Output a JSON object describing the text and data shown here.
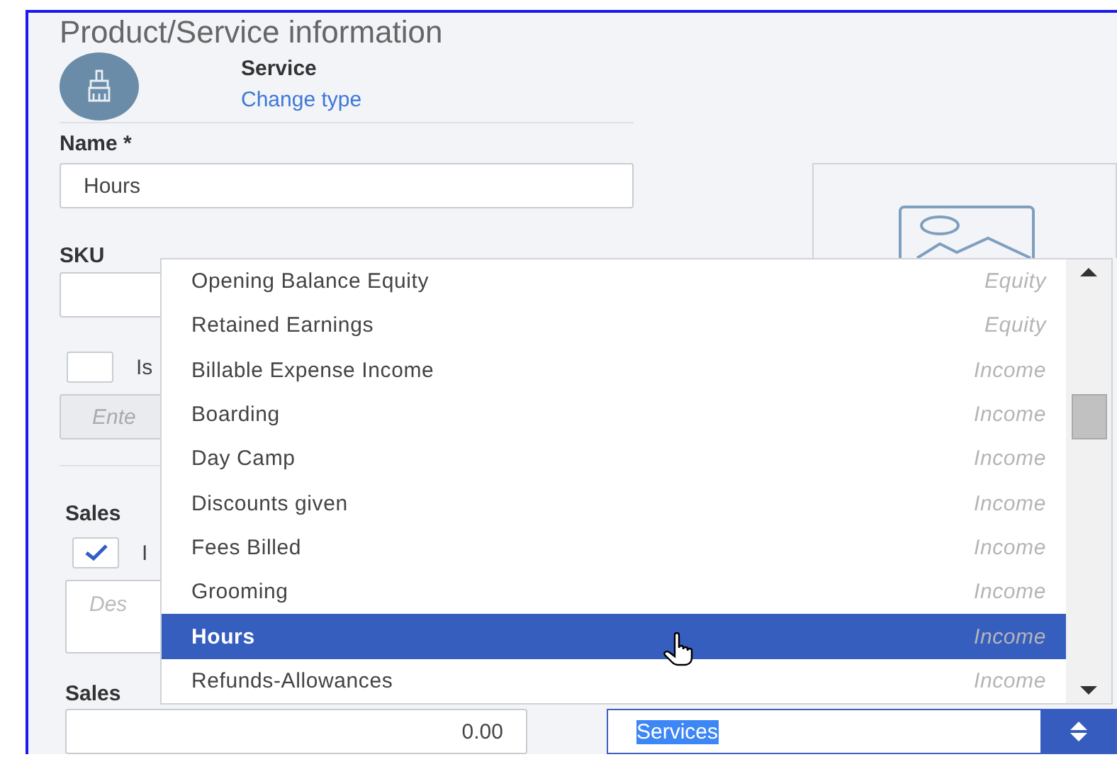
{
  "title": "Product/Service information",
  "item_type": {
    "label": "Service",
    "link": "Change type"
  },
  "name_field": {
    "label": "Name *",
    "value": "Hours"
  },
  "sku_field": {
    "label": "SKU"
  },
  "sub_product": {
    "checked": false,
    "label": "Is"
  },
  "parent_field": {
    "placeholder": "Ente",
    "disabled": true
  },
  "sales": {
    "heading": "Sales",
    "sell_checkbox": {
      "checked": true,
      "label": "I"
    },
    "description": {
      "placeholder": "Des"
    }
  },
  "price": {
    "label": "Sales",
    "value": "0.00"
  },
  "income_account": {
    "value": "Services"
  },
  "account_dropdown": {
    "items": [
      {
        "name": "Opening Balance Equity",
        "type": "Equity",
        "selected": false
      },
      {
        "name": "Retained Earnings",
        "type": "Equity",
        "selected": false
      },
      {
        "name": "Billable Expense Income",
        "type": "Income",
        "selected": false
      },
      {
        "name": "Boarding",
        "type": "Income",
        "selected": false
      },
      {
        "name": "Day Camp",
        "type": "Income",
        "selected": false
      },
      {
        "name": "Discounts given",
        "type": "Income",
        "selected": false
      },
      {
        "name": "Fees Billed",
        "type": "Income",
        "selected": false
      },
      {
        "name": "Grooming",
        "type": "Income",
        "selected": false
      },
      {
        "name": "Hours",
        "type": "Income",
        "selected": true
      },
      {
        "name": "Refunds-Allowances",
        "type": "Income",
        "selected": false
      }
    ]
  }
}
